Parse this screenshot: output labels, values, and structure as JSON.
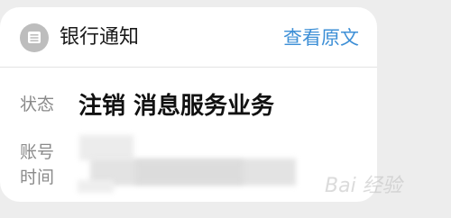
{
  "notification": {
    "title": "银行通知",
    "view_original": "查看原文",
    "icon": "message-icon"
  },
  "fields": {
    "status_label": "状态",
    "status_value": "注销 消息服务业务",
    "account_label": "账号",
    "time_label": "时间"
  },
  "watermark": {
    "text": "Bai 经验"
  },
  "colors": {
    "link": "#3d8fd6",
    "icon_bg": "#bdbdbd"
  }
}
